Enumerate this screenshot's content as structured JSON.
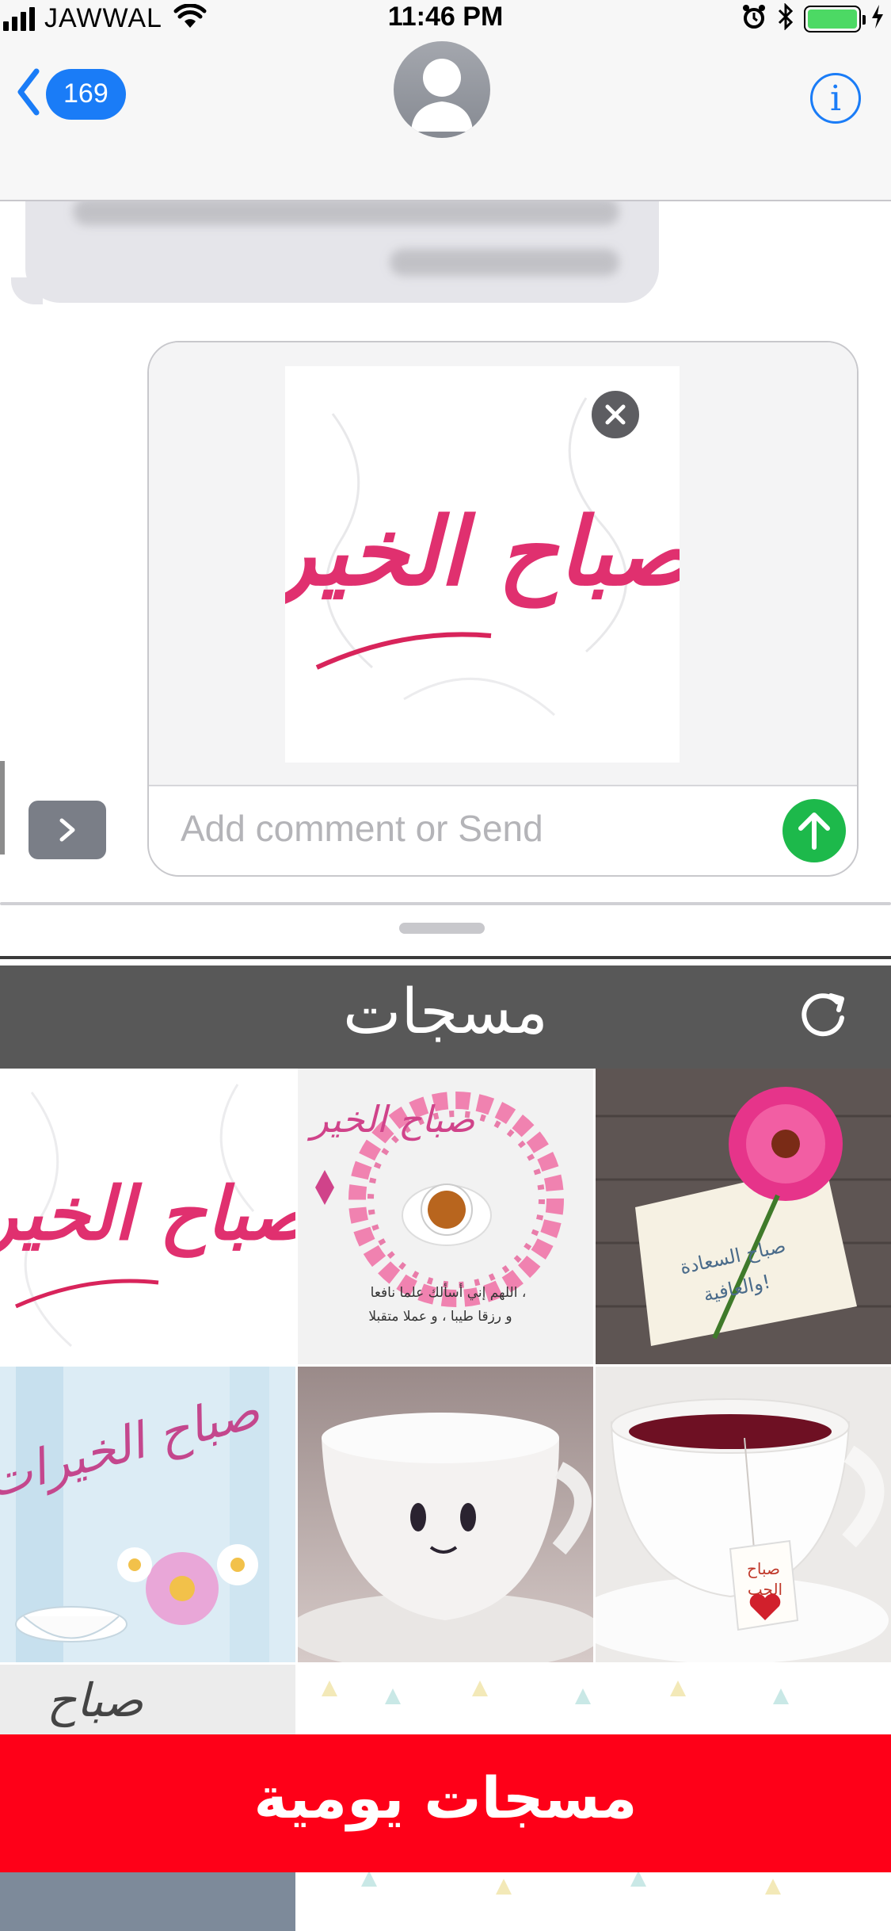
{
  "status_bar": {
    "carrier": "JAWWAL",
    "time": "11:46 PM",
    "battery_color": "#4cd964"
  },
  "navigation": {
    "unread_count": "169",
    "contact_icon": "person-silhouette-icon",
    "info_label": "i",
    "accent": "#1a7cf7"
  },
  "compose": {
    "sticker_text": "صباح الخير",
    "comment_placeholder": "Add comment or Send",
    "close_icon": "close-icon",
    "send_icon": "arrow-up-icon",
    "send_color": "#1db94b"
  },
  "app": {
    "title": "مسجات",
    "refresh_icon": "refresh-icon",
    "header_color": "#585858"
  },
  "grid": {
    "tiles": [
      {
        "caption": "صباح الخير"
      },
      {
        "caption": "صباح الخير",
        "subcaption_1": "اللهم إني أسألك علما نافعا ،",
        "subcaption_2": "و رزقا طيبا ، و عملا متقبلا"
      },
      {
        "caption": "صباح السعادة",
        "subcaption_1": "والعافية!"
      },
      {
        "caption": "صباح الخيرات"
      },
      {
        "caption": ""
      },
      {
        "caption": "صباح",
        "subcaption_1": "الحب"
      },
      {
        "caption": "صباح"
      },
      {
        "caption": ""
      }
    ]
  },
  "banner": {
    "text": "مسجات يومية",
    "color": "#fe0018"
  }
}
